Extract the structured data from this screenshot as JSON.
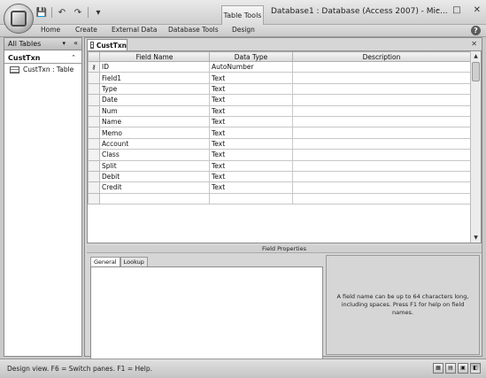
{
  "quick_access": {
    "save": "💾",
    "undo": "↶",
    "redo": "↷",
    "customize": "▾"
  },
  "context_tab": "Table Tools",
  "window_title": "Database1 : Database (Access 2007) - Mic...",
  "window_buttons": {
    "minimize": "–",
    "maximize": "□",
    "close": "✕"
  },
  "ribbon_tabs": [
    "Home",
    "Create",
    "External Data",
    "Database Tools",
    "Design"
  ],
  "help": "?",
  "nav": {
    "header": "All Tables",
    "dropdown": "▾",
    "collapse": "«",
    "group": "CustTxn",
    "group_chevron": "⌃",
    "items": [
      {
        "label": "CustTxn : Table"
      }
    ]
  },
  "document": {
    "tab": "CustTxn",
    "close": "✕"
  },
  "grid": {
    "headers": [
      "Field Name",
      "Data Type",
      "Description"
    ],
    "rows": [
      {
        "name": "ID",
        "type": "AutoNumber",
        "desc": "",
        "key": "⚷"
      },
      {
        "name": "Field1",
        "type": "Text",
        "desc": ""
      },
      {
        "name": "Type",
        "type": "Text",
        "desc": ""
      },
      {
        "name": "Date",
        "type": "Text",
        "desc": ""
      },
      {
        "name": "Num",
        "type": "Text",
        "desc": ""
      },
      {
        "name": "Name",
        "type": "Text",
        "desc": ""
      },
      {
        "name": "Memo",
        "type": "Text",
        "desc": ""
      },
      {
        "name": "Account",
        "type": "Text",
        "desc": ""
      },
      {
        "name": "Class",
        "type": "Text",
        "desc": ""
      },
      {
        "name": "Split",
        "type": "Text",
        "desc": ""
      },
      {
        "name": "Debit",
        "type": "Text",
        "desc": ""
      },
      {
        "name": "Credit",
        "type": "Text",
        "desc": ""
      },
      {
        "name": "",
        "type": "",
        "desc": ""
      }
    ]
  },
  "scrollbar": {
    "up": "▲",
    "down": "▼"
  },
  "field_properties_label": "Field Properties",
  "property_tabs": [
    "General",
    "Lookup"
  ],
  "hint_text": "A field name can be up to 64 characters long, including spaces. Press F1 for help on field names.",
  "status_text": "Design view.  F6 = Switch panes.  F1 = Help.",
  "view_buttons": [
    "▦",
    "▤",
    "▣",
    "◧"
  ]
}
